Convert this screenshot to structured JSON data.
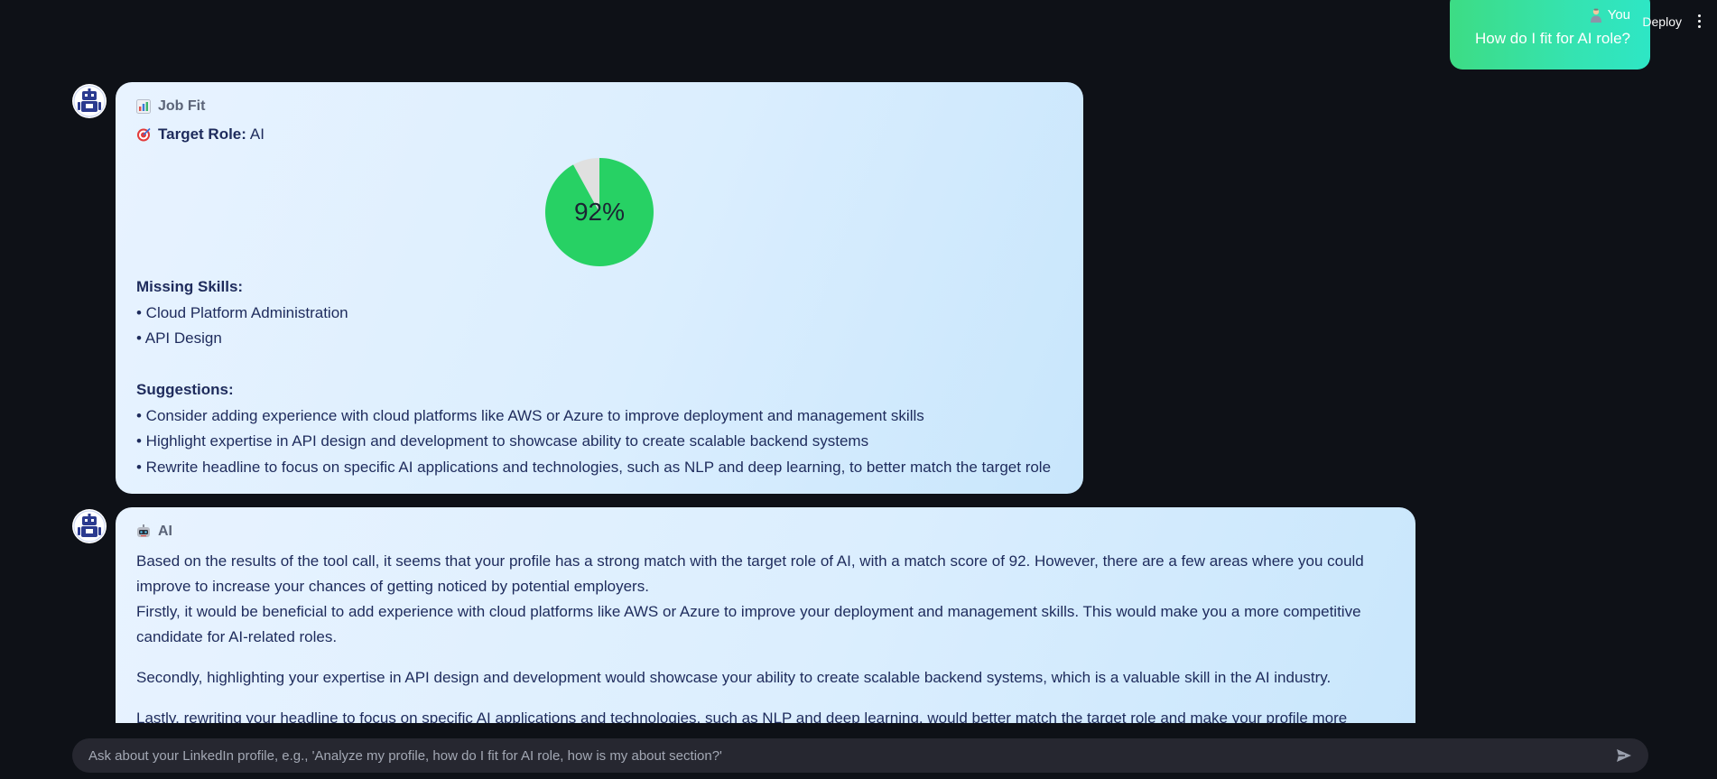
{
  "topbar": {
    "deploy_label": "Deploy"
  },
  "user_message": {
    "sender": "You",
    "text": "How do I fit for AI role?"
  },
  "job_fit": {
    "header": "Job Fit",
    "target_label": "Target Role:",
    "target_value": "AI",
    "match_percent": "92%",
    "missing_title": "Missing Skills:",
    "missing_skills": [
      "• Cloud Platform Administration",
      "• API Design"
    ],
    "suggestions_title": "Suggestions:",
    "suggestions": [
      "• Consider adding experience with cloud platforms like AWS or Azure to improve deployment and management skills",
      "• Highlight expertise in API design and development to showcase ability to create scalable backend systems",
      "• Rewrite headline to focus on specific AI applications and technologies, such as NLP and deep learning, to better match the target role"
    ]
  },
  "chart_data": {
    "type": "pie",
    "values": [
      92,
      8
    ],
    "colors": [
      "#27d164",
      "#e0e0e0"
    ],
    "center_label": "92%"
  },
  "ai_message": {
    "header": "AI",
    "paragraphs": [
      "Based on the results of the tool call, it seems that your profile has a strong match with the target role of AI, with a match score of 92. However, there are a few areas where you could improve to increase your chances of getting noticed by potential employers.",
      "Firstly, it would be beneficial to add experience with cloud platforms like AWS or Azure to improve your deployment and management skills. This would make you a more competitive candidate for AI-related roles.",
      "Secondly, highlighting your expertise in API design and development would showcase your ability to create scalable backend systems, which is a valuable skill in the AI industry.",
      "Lastly, rewriting your headline to focus on specific AI applications and technologies, such as NLP and deep learning, would better match the target role and make your profile more"
    ]
  },
  "chat_input": {
    "placeholder": "Ask about your LinkedIn profile, e.g., 'Analyze my profile, how do I fit for AI role, how is my about section?'"
  },
  "icons": {
    "bot_avatar": "robot-icon",
    "job_fit": "bar-chart-icon",
    "target": "target-icon",
    "ai": "robot-face-icon",
    "user": "person-icon",
    "send": "send-icon",
    "menu": "kebab-menu-icon"
  }
}
